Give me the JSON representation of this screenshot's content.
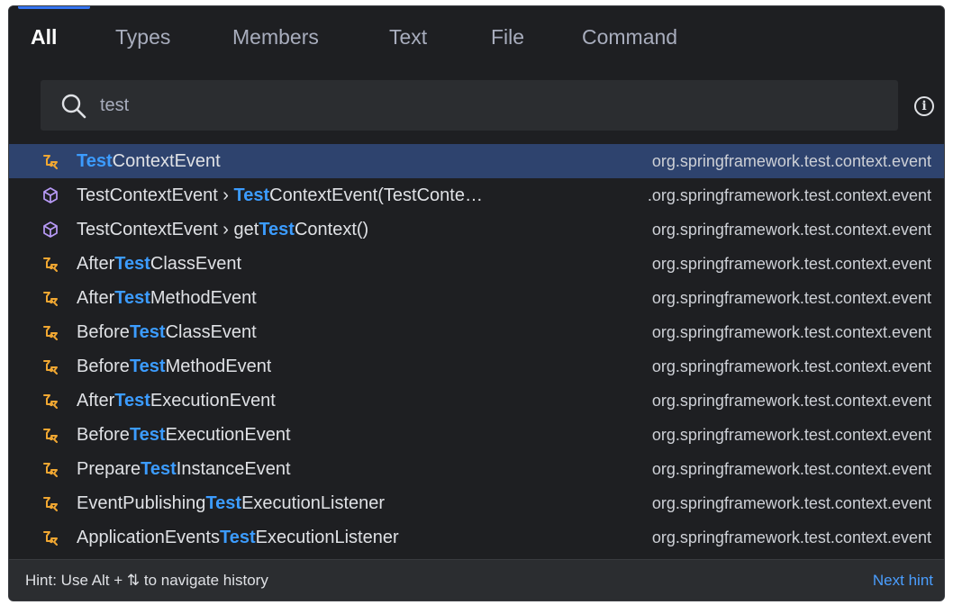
{
  "tabs": [
    {
      "label": "All",
      "active": true
    },
    {
      "label": "Types"
    },
    {
      "label": "Members"
    },
    {
      "label": "Text"
    },
    {
      "label": "File"
    },
    {
      "label": "Command"
    }
  ],
  "search": {
    "value": "test"
  },
  "results": [
    {
      "icon": "event-class-icon",
      "pre": "",
      "hl": "Test",
      "post": "ContextEvent",
      "pkg": "org.springframework.test.context.event",
      "selected": true
    },
    {
      "icon": "method-icon",
      "pre": "TestContextEvent › ",
      "hl": "Test",
      "post": "ContextEvent(TestConte…",
      "pkg": ".org.springframework.test.context.event"
    },
    {
      "icon": "method-icon",
      "pre": "TestContextEvent › get",
      "hl": "Test",
      "post": "Context()",
      "pkg": "org.springframework.test.context.event"
    },
    {
      "icon": "event-class-icon",
      "pre": "After",
      "hl": "Test",
      "post": "ClassEvent",
      "pkg": "org.springframework.test.context.event"
    },
    {
      "icon": "event-class-icon",
      "pre": "After",
      "hl": "Test",
      "post": "MethodEvent",
      "pkg": "org.springframework.test.context.event"
    },
    {
      "icon": "event-class-icon",
      "pre": "Before",
      "hl": "Test",
      "post": "ClassEvent",
      "pkg": "org.springframework.test.context.event"
    },
    {
      "icon": "event-class-icon",
      "pre": "Before",
      "hl": "Test",
      "post": "MethodEvent",
      "pkg": "org.springframework.test.context.event"
    },
    {
      "icon": "event-class-icon",
      "pre": "After",
      "hl": "Test",
      "post": "ExecutionEvent",
      "pkg": "org.springframework.test.context.event"
    },
    {
      "icon": "event-class-icon",
      "pre": "Before",
      "hl": "Test",
      "post": "ExecutionEvent",
      "pkg": "org.springframework.test.context.event"
    },
    {
      "icon": "event-class-icon",
      "pre": "Prepare",
      "hl": "Test",
      "post": "InstanceEvent",
      "pkg": "org.springframework.test.context.event"
    },
    {
      "icon": "event-class-icon",
      "pre": "EventPublishing",
      "hl": "Test",
      "post": "ExecutionListener",
      "pkg": "org.springframework.test.context.event"
    },
    {
      "icon": "event-class-icon",
      "pre": "ApplicationEvents",
      "hl": "Test",
      "post": "ExecutionListener",
      "pkg": "org.springframework.test.context.event"
    }
  ],
  "footer": {
    "hint": "Hint: Use Alt + ⇅ to navigate history",
    "next_hint": "Next hint"
  },
  "colors": {
    "accent": "#3574f0",
    "highlight": "#3c9cff",
    "class_icon": "#f0a732",
    "method_icon": "#b99bf8",
    "selection": "#2e436e"
  }
}
